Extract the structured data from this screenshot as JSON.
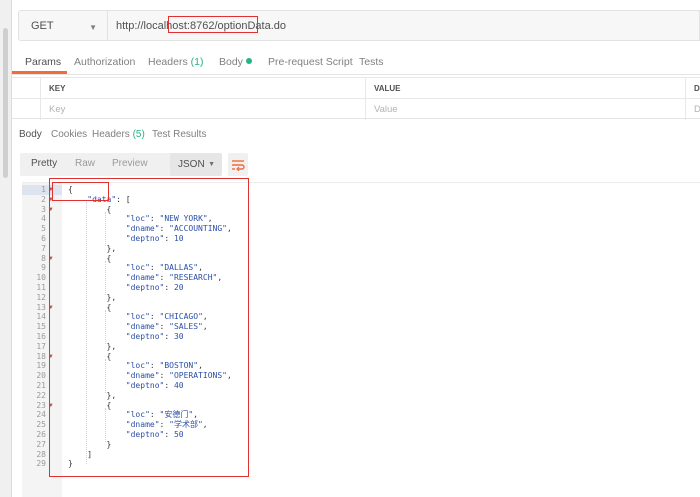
{
  "request": {
    "method": "GET",
    "url": "http://localhost:8762/optionData.do"
  },
  "request_tabs": [
    {
      "label": "Params",
      "active": true
    },
    {
      "label": "Authorization",
      "active": false
    },
    {
      "label": "Headers",
      "count": "(1)",
      "active": false
    },
    {
      "label": "Body",
      "active": false,
      "indicator": "green-dot"
    },
    {
      "label": "Pre-request Script",
      "active": false
    },
    {
      "label": "Tests",
      "active": false
    }
  ],
  "params_table": {
    "headers": [
      "KEY",
      "VALUE",
      "DES"
    ],
    "placeholders": [
      "Key",
      "Value",
      "De"
    ]
  },
  "response_tabs": [
    {
      "label": "Body",
      "active": true
    },
    {
      "label": "Cookies",
      "active": false
    },
    {
      "label": "Headers",
      "count": "(5)",
      "active": false
    },
    {
      "label": "Test Results",
      "active": false
    }
  ],
  "view_modes": {
    "pretty": "Pretty",
    "raw": "Raw",
    "preview": "Preview",
    "format": "JSON",
    "wrap_icon": "wrap-lines-icon"
  },
  "code_lines": [
    "{",
    "    \"data\": [",
    "        {",
    "            \"loc\": \"NEW YORK\",",
    "            \"dname\": \"ACCOUNTING\",",
    "            \"deptno\": 10",
    "        },",
    "        {",
    "            \"loc\": \"DALLAS\",",
    "            \"dname\": \"RESEARCH\",",
    "            \"deptno\": 20",
    "        },",
    "        {",
    "            \"loc\": \"CHICAGO\",",
    "            \"dname\": \"SALES\",",
    "            \"deptno\": 30",
    "        },",
    "        {",
    "            \"loc\": \"BOSTON\",",
    "            \"dname\": \"OPERATIONS\",",
    "            \"deptno\": 40",
    "        },",
    "        {",
    "            \"loc\": \"安德门\",",
    "            \"dname\": \"学术部\",",
    "            \"deptno\": 50",
    "        }",
    "    ]",
    "}"
  ],
  "fold_lines": [
    1,
    2,
    3,
    8,
    13,
    18,
    23
  ],
  "colors": {
    "accent": "#f26b3a",
    "green": "#26b47f",
    "annotation": "#e03030"
  }
}
